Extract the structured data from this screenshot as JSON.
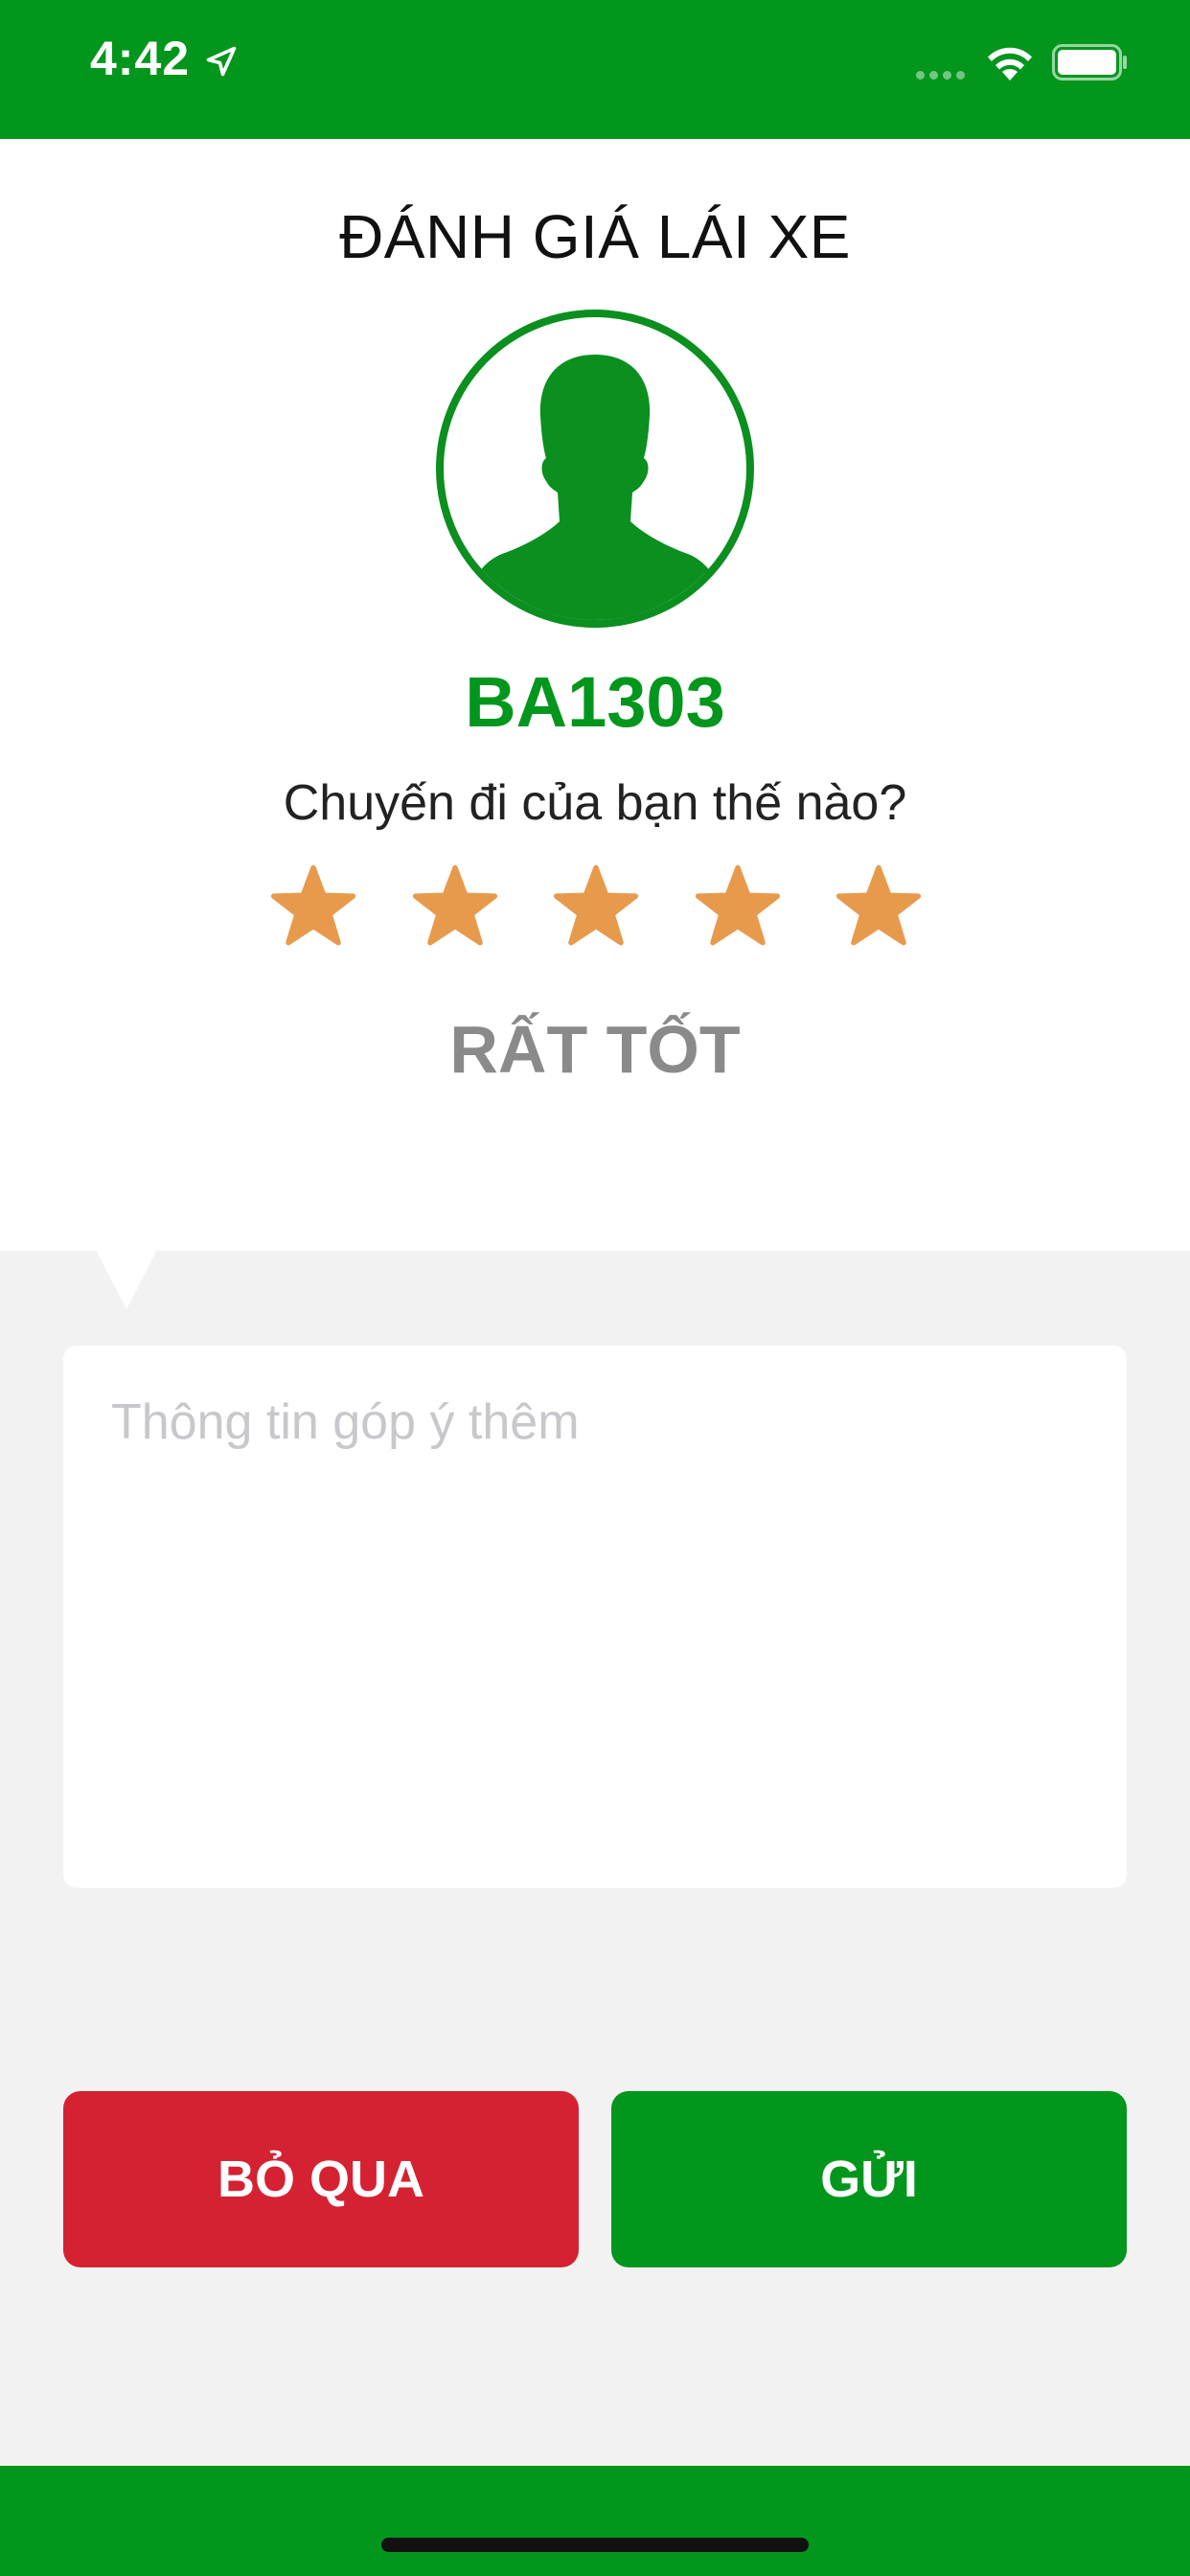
{
  "status_bar": {
    "time": "4:42",
    "icons": [
      "location-arrow-icon",
      "signal-dots-icon",
      "wifi-icon",
      "battery-icon"
    ]
  },
  "rating_screen": {
    "title": "ĐÁNH GIÁ LÁI XE",
    "driver_code": "BA1303",
    "question": "Chuyến đi của bạn thế nào?",
    "rating": 5,
    "max_rating": 5,
    "rating_label": "RẤT TỐT"
  },
  "feedback": {
    "placeholder": "Thông tin góp ý thêm",
    "value": ""
  },
  "buttons": {
    "skip_label": "BỎ QUA",
    "send_label": "GỬI"
  },
  "colors": {
    "brand_green": "#03961d",
    "skip_red": "#d42233",
    "star_orange": "#e89a4c",
    "label_gray": "#8a8a8a"
  }
}
